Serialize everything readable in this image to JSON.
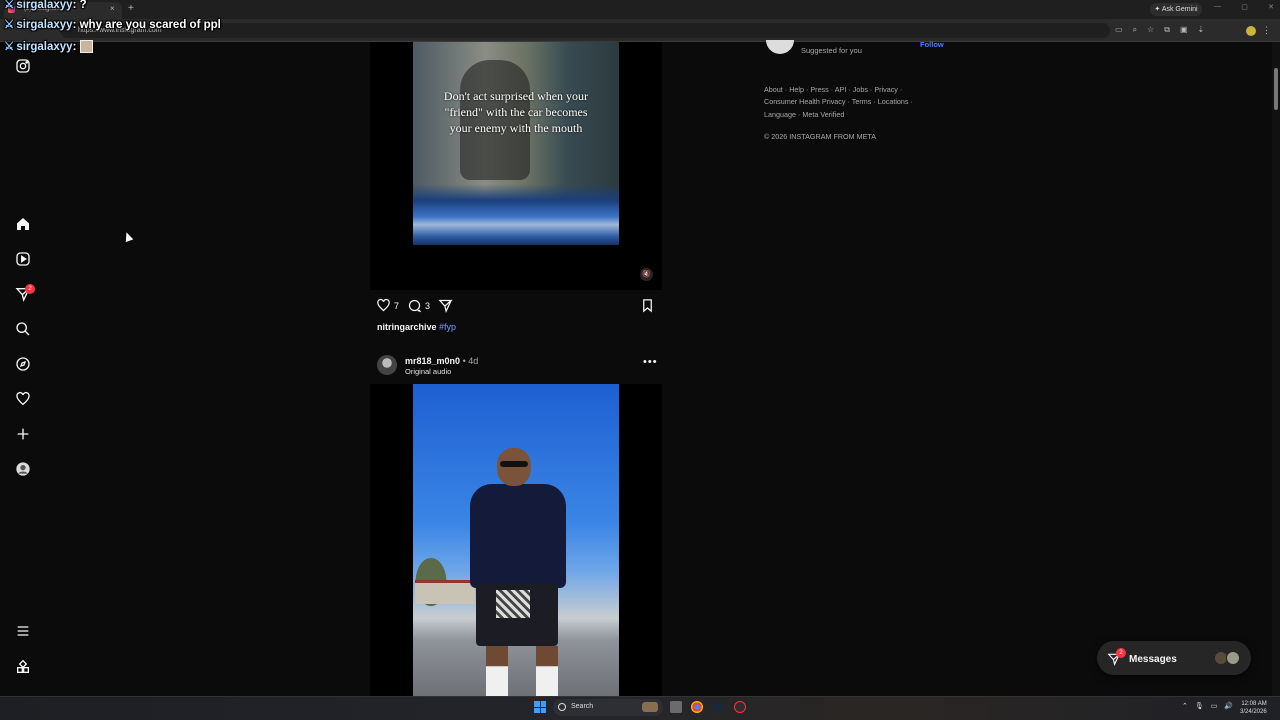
{
  "browser": {
    "tab_title": "(2) Instagram",
    "url": "https://www.instagram.com",
    "ask_gemini_label": "Ask Gemini",
    "new_tab_label": "+",
    "tab_close_label": "×"
  },
  "chat": [
    {
      "user": "sirgalaxyy",
      "message": "?"
    },
    {
      "user": "sirgalaxyy",
      "message": "why are you scared of ppl"
    },
    {
      "user": "sirgalaxyy",
      "message": ""
    }
  ],
  "sidebar": {
    "notifications_badge": "2"
  },
  "post1": {
    "overlay_text": "Don't act surprised when your \"friend\" with the car becomes your enemy with the mouth",
    "likes": "7",
    "comments": "3",
    "caption_user": "nitringarchive",
    "caption_tag": "#fyp"
  },
  "post2": {
    "username": "mr818_m0n0",
    "age": "4d",
    "audio": "Original audio",
    "more_label": "•••"
  },
  "right": {
    "suggested_text": "Suggested for you",
    "follow_label": "Follow",
    "footer_links": [
      "About",
      "Help",
      "Press",
      "API",
      "Jobs",
      "Privacy",
      "Consumer Health Privacy",
      "Terms",
      "Locations",
      "Language",
      "Meta Verified"
    ],
    "copyright": "© 2026 INSTAGRAM FROM META"
  },
  "messages": {
    "label": "Messages",
    "badge": "2"
  },
  "taskbar": {
    "search_label": "Search",
    "time": "12:08 AM",
    "date": "3/24/2026"
  },
  "colors": {
    "link_blue": "#4a7dff",
    "badge_red": "#ff3040",
    "hashtag": "#7b9cff"
  }
}
